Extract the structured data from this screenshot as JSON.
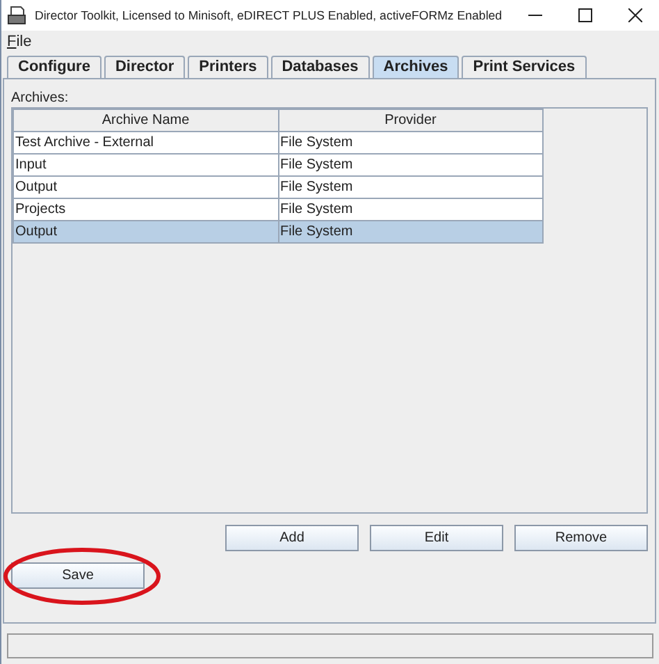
{
  "window": {
    "title": "Director Toolkit, Licensed to Minisoft, eDIRECT PLUS Enabled, activeFORMz Enabled"
  },
  "menu": [
    {
      "label": "File"
    }
  ],
  "tabs": [
    {
      "label": "Configure",
      "selected": false
    },
    {
      "label": "Director",
      "selected": false
    },
    {
      "label": "Printers",
      "selected": false
    },
    {
      "label": "Databases",
      "selected": false
    },
    {
      "label": "Archives",
      "selected": true
    },
    {
      "label": "Print Services",
      "selected": false
    }
  ],
  "archives": {
    "label": "Archives:",
    "columns": [
      "Archive Name",
      "Provider"
    ],
    "rows": [
      {
        "cells": [
          "Test Archive - External",
          "File System"
        ],
        "selected": false
      },
      {
        "cells": [
          "Input",
          "File System"
        ],
        "selected": false
      },
      {
        "cells": [
          "Output",
          "File System"
        ],
        "selected": false
      },
      {
        "cells": [
          "Projects",
          "File System"
        ],
        "selected": false
      },
      {
        "cells": [
          "Output",
          "File System"
        ],
        "selected": true
      }
    ]
  },
  "actions": [
    "Add",
    "Edit",
    "Remove"
  ],
  "save_button": {
    "label": "Save",
    "highlighted": true
  }
}
